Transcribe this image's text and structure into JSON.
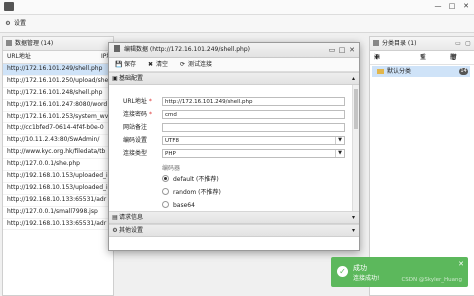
{
  "window": {
    "controls": [
      "—",
      "□",
      "✕"
    ]
  },
  "toolbar": {
    "settings_label": "设置",
    "settings_icon": "gear-icon"
  },
  "data_panel": {
    "title": "数据管理 (14)",
    "columns": [
      "URL地址",
      "IP地"
    ],
    "rows": [
      "http://172.16.101.249/shell.php",
      "http://172.16.101.250/upload/she",
      "http://172.16.101.248/shell.php",
      "http://172.16.101.247:8080/word",
      "http://172.16.101.253/system_wv",
      "http://cc1bfed7-0614-4f4f-b0e-0",
      "http://10.11.2.43:80/SwAdmin/",
      "http://www.kyc.org.hk/filedata/tb",
      "http://127.0.0.1/she.php",
      "http://192.168.10.153/uploaded_i",
      "http://192.168.10.153/uploaded_i",
      "http://192.168.10.133:65531/adr",
      "http://127.0.0.1/small7998.jsp",
      "http://192.168.10.133:65531/adr"
    ]
  },
  "category_panel": {
    "title": "分类目录 (1)",
    "add_label": "添加",
    "rename_label": "重",
    "delete_label": "删",
    "item_label": "默认分类",
    "item_count": "14"
  },
  "dialog": {
    "title": "编辑数据 (http://172.16.101.249/shell.php)",
    "save_label": "保存",
    "clear_label": "清空",
    "test_label": "测试连接",
    "basic_section": "基础配置",
    "fields": {
      "url_label": "URL地址",
      "url_value": "http://172.16.101.249/shell.php",
      "password_label": "连接密码",
      "password_value": "cmd",
      "note_label": "网站备注",
      "note_value": "",
      "encoding_label": "编码设置",
      "encoding_value": "UTF8",
      "type_label": "连接类型",
      "type_value": "PHP",
      "encoder_group": "编码器",
      "encoders": [
        "default (不推荐)",
        "random (不推荐)",
        "base64"
      ]
    },
    "request_section": "请求信息",
    "other_section": "其他设置"
  },
  "toast": {
    "title": "成功",
    "message": "连接成功!",
    "close": "✕",
    "watermark": "CSDN @Skyler_Huang"
  },
  "colors": {
    "selection": "#cfe3f8",
    "toast_bg": "#5cb85c",
    "required": "#d33333"
  }
}
